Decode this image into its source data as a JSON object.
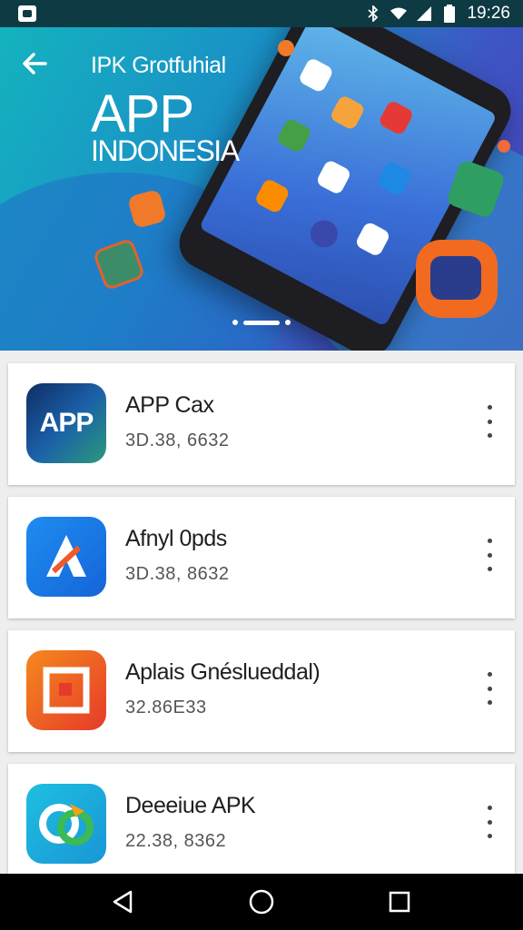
{
  "status_bar": {
    "time": "19:26",
    "icons": [
      "app-notification-icon",
      "bluetooth-icon",
      "wifi-icon",
      "signal-icon",
      "battery-icon"
    ]
  },
  "hero": {
    "subtitle": "IPK Grotfuhial",
    "title": "APP",
    "country": "INDONESIA",
    "back_icon": "back-arrow-icon"
  },
  "apps": [
    {
      "name": "APP Cax",
      "meta": "3D.38, 6632",
      "icon": "app-logo-icon",
      "icon_text": "APP",
      "colors": [
        "#1b5fa8",
        "#2b9a7c",
        "#0e2e63"
      ]
    },
    {
      "name": "Afnyl 0pds",
      "meta": "3D.38, 8632",
      "icon": "blue-a-logo-icon",
      "colors": [
        "#1e8cf0",
        "#1565d8"
      ]
    },
    {
      "name": "Aplais Gnéslueddal)",
      "meta": "32.86E33",
      "icon": "orange-frame-logo-icon",
      "colors": [
        "#f36a1c",
        "#e63a2a"
      ]
    },
    {
      "name": "Deeeiue APK",
      "meta": "22.38, 8362",
      "icon": "teal-swirl-logo-icon",
      "colors": [
        "#1dbfe0",
        "#1a96d6"
      ]
    }
  ],
  "more_icon": "more-vert-icon",
  "nav": {
    "back": "nav-back-icon",
    "home": "nav-home-icon",
    "recents": "nav-recents-icon"
  }
}
